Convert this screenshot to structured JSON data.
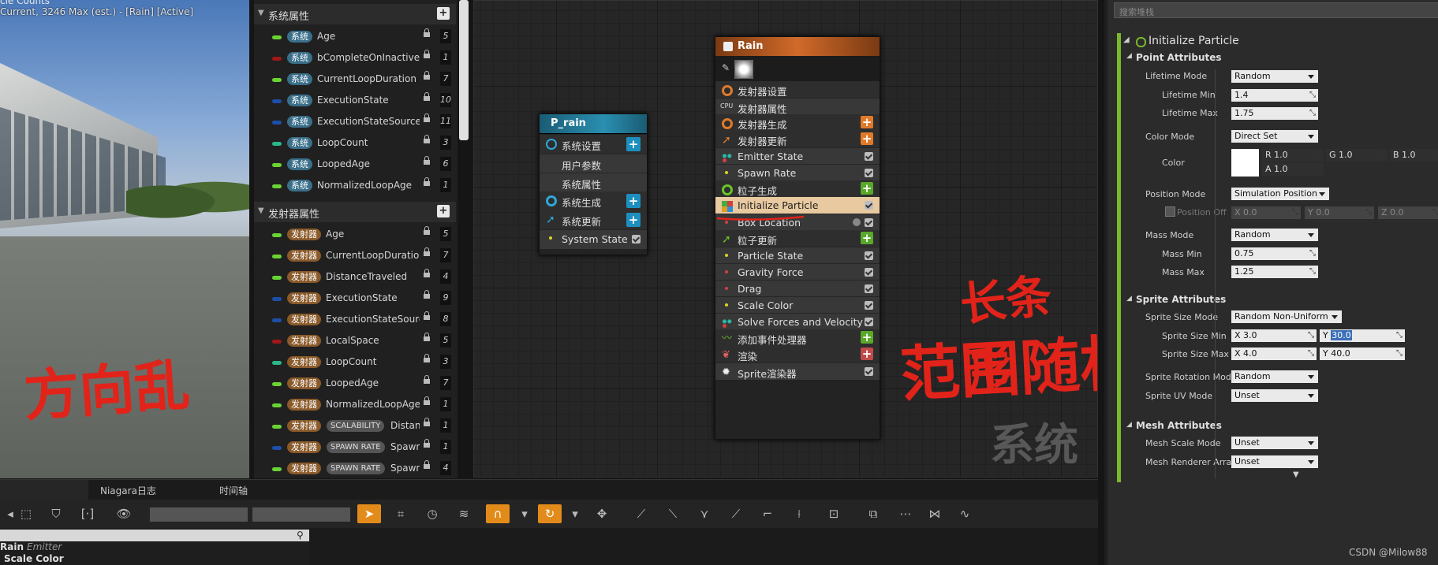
{
  "viewport": {
    "info_line1": "cle Counts",
    "info_line2": "Current, 3246 Max (est.) - [Rain] [Active]",
    "handwriting": "方向乱"
  },
  "params_panel": {
    "system_section": "系统属性",
    "system_params": [
      {
        "tag": "系统",
        "name": "Age",
        "num": "5",
        "pill": "#6bd235"
      },
      {
        "tag": "系统",
        "name": "bCompleteOnInactive",
        "num": "1",
        "pill": "#a01818"
      },
      {
        "tag": "系统",
        "name": "CurrentLoopDuration",
        "num": "7",
        "pill": "#6bd235"
      },
      {
        "tag": "系统",
        "name": "ExecutionState",
        "num": "10",
        "pill": "#1c4fa8"
      },
      {
        "tag": "系统",
        "name": "ExecutionStateSource",
        "num": "11",
        "pill": "#1c4fa8"
      },
      {
        "tag": "系统",
        "name": "LoopCount",
        "num": "3",
        "pill": "#2ab88a"
      },
      {
        "tag": "系统",
        "name": "LoopedAge",
        "num": "6",
        "pill": "#6bd235"
      },
      {
        "tag": "系统",
        "name": "NormalizedLoopAge",
        "num": "1",
        "pill": "#6bd235"
      }
    ],
    "emitter_section": "发射器属性",
    "emitter_params": [
      {
        "tag": "发射器",
        "name": "Age",
        "num": "5",
        "pill": "#6bd235",
        "tag2": ""
      },
      {
        "tag": "发射器",
        "name": "CurrentLoopDuration",
        "num": "7",
        "pill": "#6bd235",
        "tag2": ""
      },
      {
        "tag": "发射器",
        "name": "DistanceTraveled",
        "num": "4",
        "pill": "#6bd235",
        "tag2": ""
      },
      {
        "tag": "发射器",
        "name": "ExecutionState",
        "num": "9",
        "pill": "#1c4fa8",
        "tag2": ""
      },
      {
        "tag": "发射器",
        "name": "ExecutionStateSource",
        "num": "8",
        "pill": "#1c4fa8",
        "tag2": ""
      },
      {
        "tag": "发射器",
        "name": "LocalSpace",
        "num": "5",
        "pill": "#a01818",
        "tag2": ""
      },
      {
        "tag": "发射器",
        "name": "LoopCount",
        "num": "3",
        "pill": "#2ab88a",
        "tag2": ""
      },
      {
        "tag": "发射器",
        "name": "LoopedAge",
        "num": "7",
        "pill": "#6bd235",
        "tag2": ""
      },
      {
        "tag": "发射器",
        "name": "NormalizedLoopAge",
        "num": "1",
        "pill": "#6bd235",
        "tag2": ""
      },
      {
        "tag": "发射器",
        "name": "Distan",
        "num": "1",
        "pill": "#6bd235",
        "tag2": "SCALABILITY"
      },
      {
        "tag": "发射器",
        "name": "Spawn",
        "num": "1",
        "pill": "#1c4fa8",
        "tag2": "SPAWN RATE"
      },
      {
        "tag": "发射器",
        "name": "Spawn",
        "num": "4",
        "pill": "#6bd235",
        "tag2": "SPAWN RATE"
      }
    ]
  },
  "system_node": {
    "title": "P_rain",
    "rows": [
      "系统设置",
      "用户参数",
      "系统属性",
      "系统生成",
      "系统更新",
      "System State"
    ]
  },
  "emitter_node": {
    "title": "Rain",
    "rows": [
      "发射器设置",
      "发射器属性",
      "发射器生成",
      "发射器更新",
      "Emitter State",
      "Spawn Rate",
      "粒子生成",
      "Initialize Particle",
      "Box Location",
      "粒子更新",
      "Particle State",
      "Gravity Force",
      "Drag",
      "Scale Color",
      "Solve Forces and Velocity",
      "添加事件处理器",
      "渲染",
      "Sprite渲染器"
    ]
  },
  "annotations": {
    "long_strip": "长条形",
    "random_range": "范围随机",
    "watermark": "系统"
  },
  "bottom": {
    "tabs": [
      "Niagara日志",
      "时间轴"
    ],
    "emitter_name": "Rain",
    "emitter_label": "Emitter",
    "module_name": "Scale Color"
  },
  "details": {
    "search_placeholder": "搜索堆栈",
    "module_title": "Initialize Particle",
    "point_attributes": "Point Attributes",
    "lifetime_mode_label": "Lifetime Mode",
    "lifetime_mode": "Random",
    "lifetime_min_label": "Lifetime Min",
    "lifetime_min": "1.4",
    "lifetime_max_label": "Lifetime Max",
    "lifetime_max": "1.75",
    "color_mode_label": "Color Mode",
    "color_mode": "Direct Set",
    "color_label": "Color",
    "color_r": "R 1.0",
    "color_g": "G 1.0",
    "color_b": "B 1.0",
    "color_a": "A 1.0",
    "position_mode_label": "Position Mode",
    "position_mode": "Simulation Position",
    "position_offset_label": "Position Off",
    "pos_x": "X 0.0",
    "pos_y": "Y 0.0",
    "pos_z": "Z 0.0",
    "mass_mode_label": "Mass Mode",
    "mass_mode": "Random",
    "mass_min_label": "Mass Min",
    "mass_min": "0.75",
    "mass_max_label": "Mass Max",
    "mass_max": "1.25",
    "sprite_attributes": "Sprite Attributes",
    "sprite_size_mode_label": "Sprite Size Mode",
    "sprite_size_mode": "Random Non-Uniform",
    "sprite_size_min_label": "Sprite Size Min",
    "sprite_size_min_x": "X 3.0",
    "sprite_size_min_y_prefix": "Y",
    "sprite_size_min_y": "30.0",
    "sprite_size_max_label": "Sprite Size Max",
    "sprite_size_max_x": "X 4.0",
    "sprite_size_max_y": "Y 40.0",
    "sprite_rotation_label": "Sprite Rotation Mod",
    "sprite_rotation": "Random",
    "sprite_uv_label": "Sprite UV Mode",
    "sprite_uv": "Unset",
    "mesh_attributes": "Mesh Attributes",
    "mesh_scale_label": "Mesh Scale Mode",
    "mesh_scale": "Unset",
    "mesh_renderer_label": "Mesh Renderer Arra",
    "mesh_renderer": "Unset"
  },
  "credit": "CSDN @Milow88"
}
